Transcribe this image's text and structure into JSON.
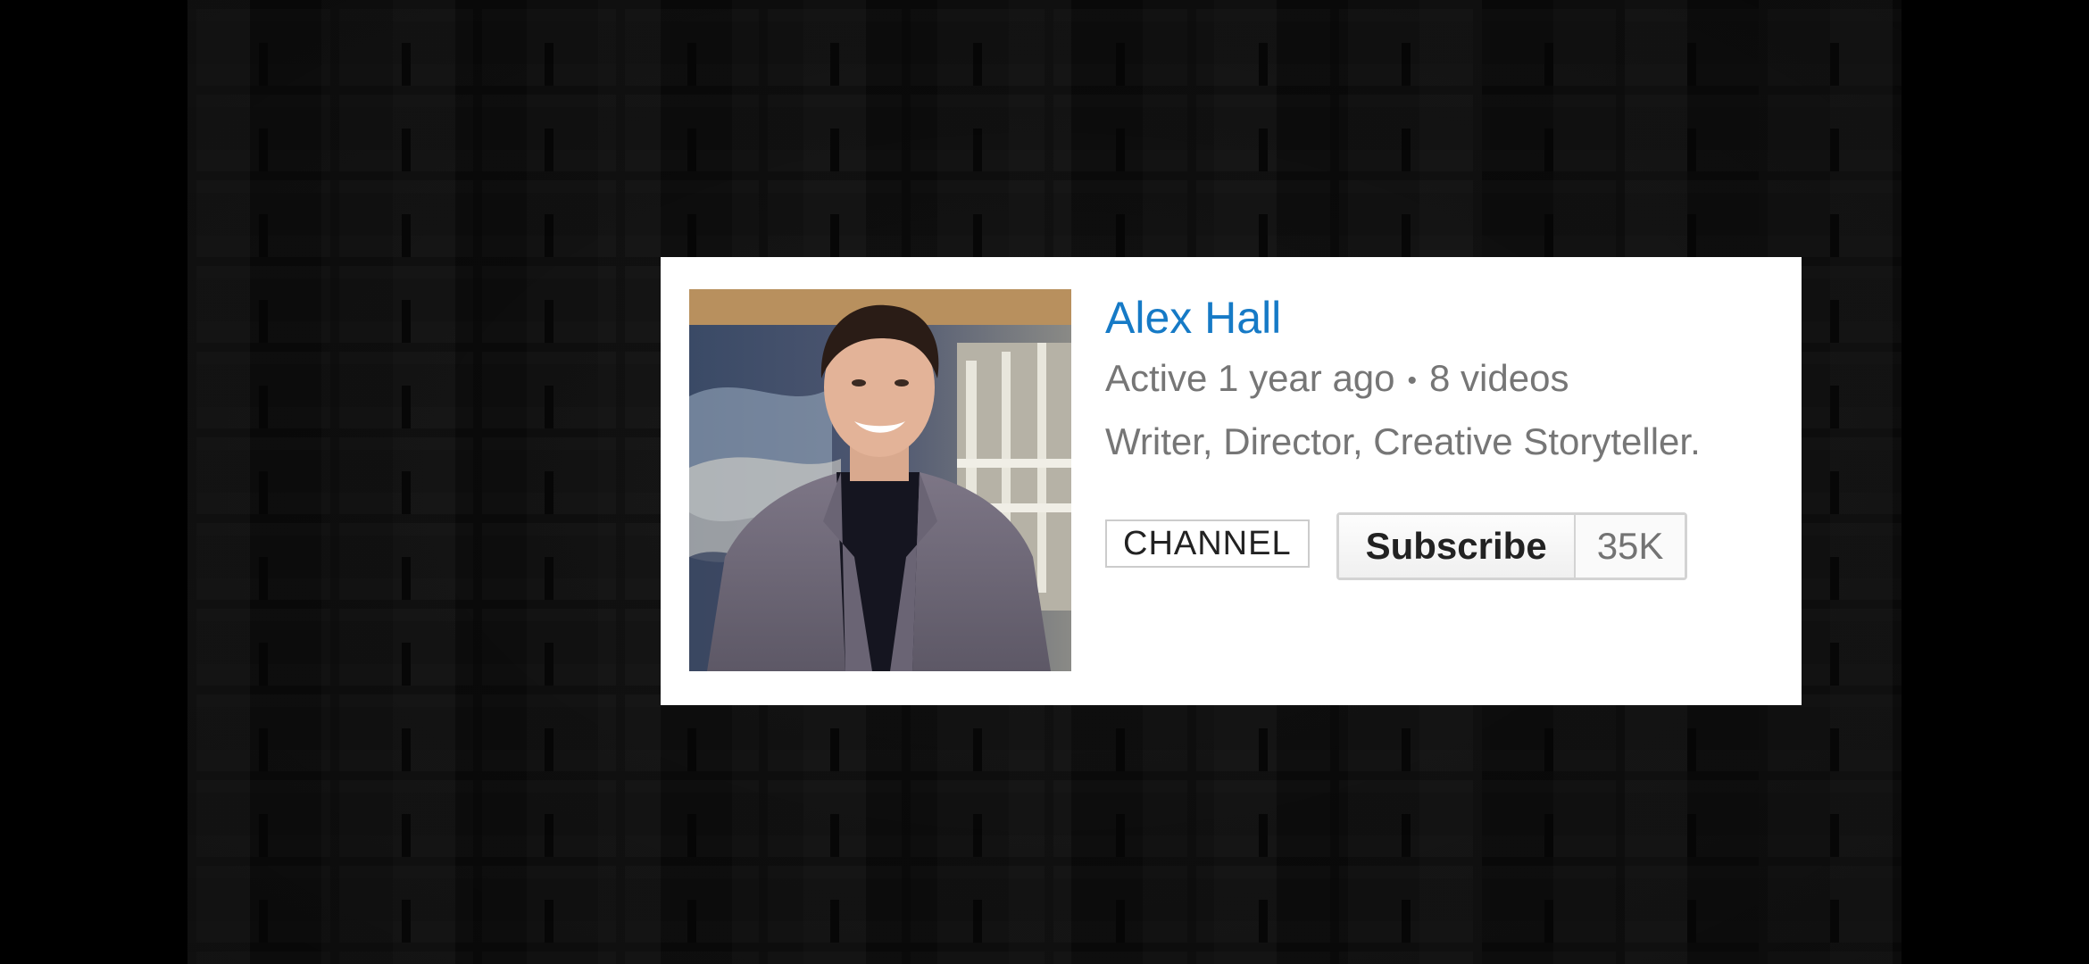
{
  "channel_card": {
    "name": "Alex Hall",
    "activity": "Active 1 year ago",
    "separator": "•",
    "video_count": "8 videos",
    "description": "Writer, Director, Creative Storyteller.",
    "channel_button_label": "CHANNEL",
    "subscribe_label": "Subscribe",
    "subscriber_count": "35K"
  },
  "colors": {
    "name_link": "#167ac6",
    "meta_text": "#767676",
    "card_background": "#ffffff",
    "background": "#000000"
  },
  "icons": {
    "avatar": "profile-photo"
  }
}
